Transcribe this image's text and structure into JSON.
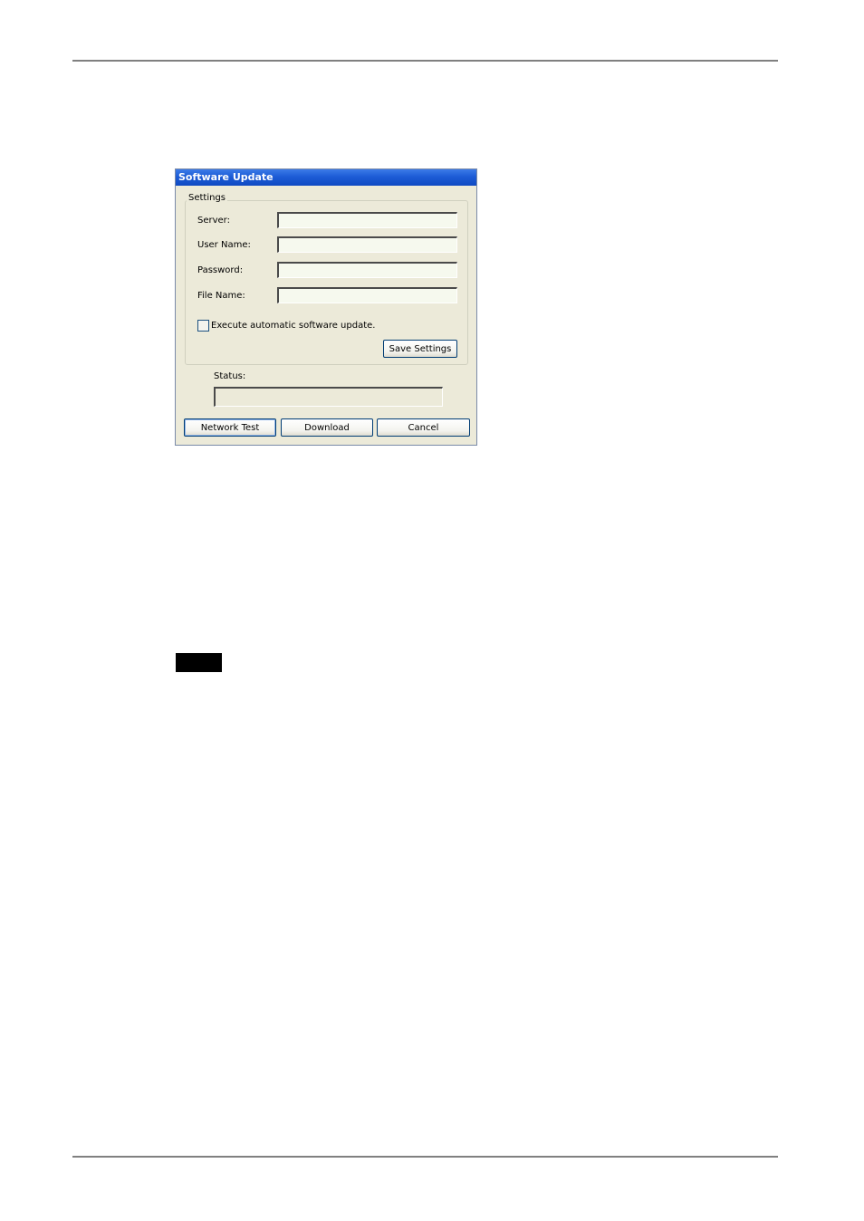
{
  "dialog": {
    "title": "Software Update",
    "settings": {
      "legend": "Settings",
      "fields": [
        {
          "label": "Server:",
          "value": ""
        },
        {
          "label": "User Name:",
          "value": ""
        },
        {
          "label": "Password:",
          "value": ""
        },
        {
          "label": "File Name:",
          "value": ""
        }
      ],
      "auto_update": {
        "label": "Execute automatic software update.",
        "checked": false
      },
      "save_label": "Save Settings"
    },
    "status": {
      "label": "Status:",
      "value": ""
    },
    "buttons": {
      "network_test": "Network Test",
      "download": "Download",
      "cancel": "Cancel"
    }
  },
  "colors": {
    "titlebar": "#0f49c2",
    "dialog_bg": "#ecead9",
    "input_bg": "#f6f9ee",
    "note_badge": "#000000"
  }
}
